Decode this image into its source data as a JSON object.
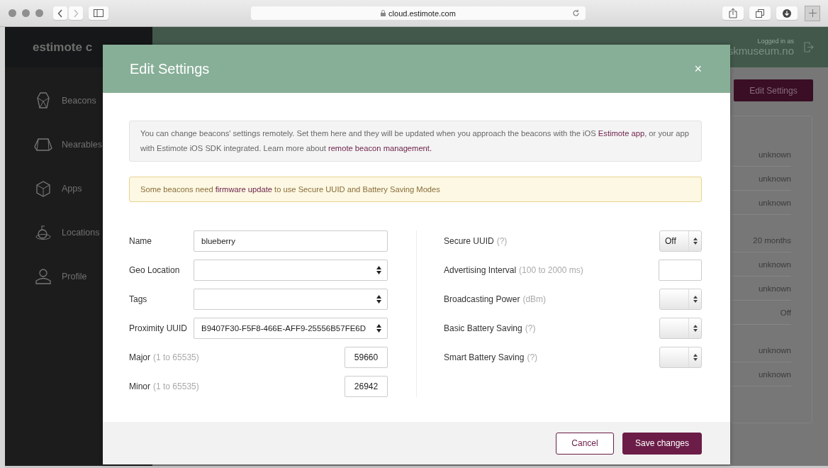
{
  "browser": {
    "url": "cloud.estimote.com"
  },
  "app": {
    "logo": "estimote c",
    "sidebar": {
      "items": [
        {
          "label": "Beacons",
          "kind": "beacon"
        },
        {
          "label": "Nearables",
          "kind": "nearable"
        },
        {
          "label": "Apps",
          "kind": "box"
        },
        {
          "label": "Locations",
          "kind": "location"
        },
        {
          "label": "Profile",
          "kind": "person"
        }
      ]
    },
    "header": {
      "logged_in_caption": "Logged in as",
      "user": "skmuseum.no"
    },
    "edit_button": "Edit Settings",
    "details": {
      "groups": [
        [
          "unknown",
          "unknown",
          "unknown"
        ],
        [
          "20 months",
          "unknown",
          "unknown",
          "Off"
        ],
        [
          "unknown",
          "unknown"
        ]
      ]
    }
  },
  "modal": {
    "title": "Edit Settings",
    "close": "×",
    "info": [
      {
        "kind": "text",
        "text": "You can change beacons' settings remotely. Set them here and they will be updated when you approach the beacons with the iOS "
      },
      {
        "kind": "link",
        "text": "Estimote app"
      },
      {
        "kind": "text",
        "text": ", or your app with Estimote iOS SDK integrated. Learn more about "
      },
      {
        "kind": "link",
        "text": "remote beacon management."
      }
    ],
    "warning": [
      {
        "kind": "text",
        "text": "Some beacons need "
      },
      {
        "kind": "link",
        "text": "firmware update"
      },
      {
        "kind": "text",
        "text": " to use Secure UUID and Battery Saving Modes"
      }
    ],
    "left_fields": [
      {
        "label": "Name",
        "kind": "text",
        "value": "blueberry"
      },
      {
        "label": "Geo Location",
        "kind": "select"
      },
      {
        "label": "Tags",
        "kind": "select"
      },
      {
        "label": "Proximity UUID",
        "kind": "select",
        "value": "B9407F30-F5F8-466E-AFF9-25556B57FE6D"
      },
      {
        "label": "Major",
        "hint": "(1 to 65535)",
        "kind": "number",
        "value": "59660"
      },
      {
        "label": "Minor",
        "hint": "(1 to 65535)",
        "kind": "number",
        "value": "26942"
      }
    ],
    "right_fields": [
      {
        "label": "Secure UUID",
        "hint": "(?)",
        "kind": "select",
        "value": "Off"
      },
      {
        "label": "Advertising Interval",
        "hint": "(100 to 2000 ms)",
        "kind": "number"
      },
      {
        "label": "Broadcasting Power",
        "hint": "(dBm)",
        "kind": "select"
      },
      {
        "label": "Basic Battery Saving",
        "hint": "(?)",
        "kind": "select"
      },
      {
        "label": "Smart Battery Saving",
        "hint": "(?)",
        "kind": "select"
      }
    ],
    "buttons": [
      {
        "label": "Cancel",
        "kind": "secondary"
      },
      {
        "label": "Save changes",
        "kind": "primary"
      }
    ]
  }
}
